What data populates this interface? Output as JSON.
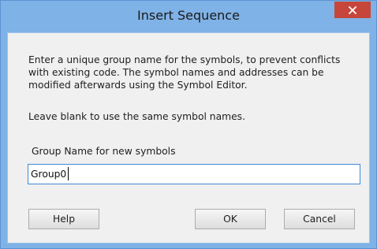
{
  "window": {
    "title": "Insert Sequence",
    "close_icon": "close-icon"
  },
  "dialog": {
    "message_line1": "Enter a unique group name for the symbols, to prevent conflicts",
    "message_line2": "with existing code. The symbol names and addresses can be",
    "message_line3": "modified afterwards using the Symbol Editor.",
    "message_blank": "Leave blank to use the same symbol names.",
    "field_label": "Group Name for new symbols",
    "field_value": "Group0"
  },
  "buttons": {
    "help": "Help",
    "ok": "OK",
    "cancel": "Cancel"
  },
  "colors": {
    "titlebar": "#7fb2e6",
    "close": "#c7463b",
    "input_border": "#3f8ad8"
  }
}
